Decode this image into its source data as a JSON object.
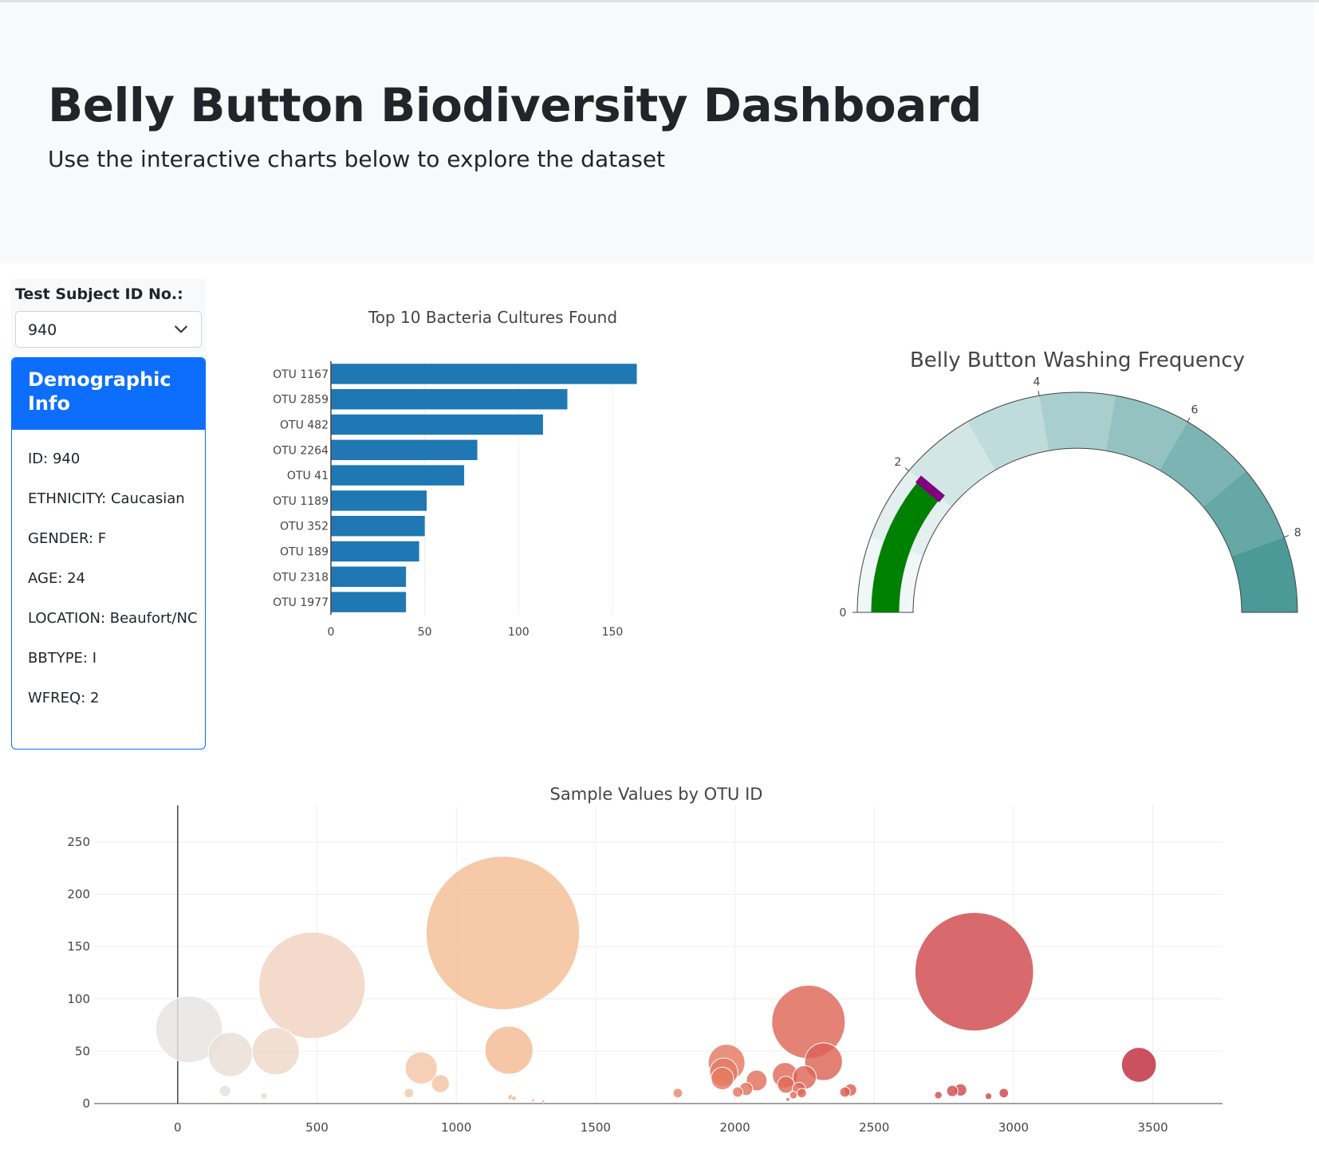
{
  "header": {
    "title": "Belly Button Biodiversity Dashboard",
    "subtitle": "Use the interactive charts below to explore the dataset"
  },
  "selector": {
    "label": "Test Subject ID No.:",
    "selected": "940"
  },
  "demographics": {
    "title": "Demographic Info",
    "entries": [
      "ID: 940",
      "ETHNICITY: Caucasian",
      "GENDER: F",
      "AGE: 24",
      "LOCATION: Beaufort/NC",
      "BBTYPE: I",
      "WFREQ: 2"
    ]
  },
  "colors": {
    "bar": "#1f77b4",
    "panel_accent": "#0d6efd",
    "gauge_value": "#008000",
    "gauge_threshold": "#800080"
  },
  "chart_data": [
    {
      "type": "bar",
      "orientation": "horizontal",
      "title": "Top 10 Bacteria Cultures Found",
      "categories": [
        "OTU 1167",
        "OTU 2859",
        "OTU 482",
        "OTU 2264",
        "OTU 41",
        "OTU 1189",
        "OTU 352",
        "OTU 189",
        "OTU 2318",
        "OTU 1977"
      ],
      "values": [
        163,
        126,
        113,
        78,
        71,
        51,
        50,
        47,
        40,
        40
      ],
      "xlim": [
        0,
        170
      ],
      "xticks": [
        0,
        50,
        100,
        150
      ],
      "grid": true
    },
    {
      "type": "gauge",
      "title": "Belly Button Washing Frequency",
      "value": 2,
      "threshold": 2,
      "range": [
        0,
        9
      ],
      "ticks": [
        0,
        2,
        4,
        6,
        8
      ],
      "steps": [
        {
          "range": [
            0,
            1
          ],
          "color": "#f0f7f7"
        },
        {
          "range": [
            1,
            2
          ],
          "color": "#e4f0f0"
        },
        {
          "range": [
            2,
            3
          ],
          "color": "#d3e6e6"
        },
        {
          "range": [
            3,
            4
          ],
          "color": "#c0dbdb"
        },
        {
          "range": [
            4,
            5
          ],
          "color": "#a8cece"
        },
        {
          "range": [
            5,
            6
          ],
          "color": "#94c2c1"
        },
        {
          "range": [
            6,
            7
          ],
          "color": "#7bb4b3"
        },
        {
          "range": [
            7,
            8
          ],
          "color": "#65a8a6"
        },
        {
          "range": [
            8,
            9
          ],
          "color": "#4c9a98"
        }
      ]
    },
    {
      "type": "scatter",
      "mode": "bubble",
      "title": "Sample Values by OTU ID",
      "xlim": [
        -300,
        3750
      ],
      "ylim": [
        0,
        285
      ],
      "xticks": [
        0,
        500,
        1000,
        1500,
        2000,
        2500,
        3000,
        3500
      ],
      "yticks": [
        0,
        50,
        100,
        150,
        200,
        250
      ],
      "grid": true,
      "points": [
        {
          "x": 41,
          "y": 71
        },
        {
          "x": 170,
          "y": 12
        },
        {
          "x": 189,
          "y": 47
        },
        {
          "x": 310,
          "y": 7
        },
        {
          "x": 352,
          "y": 50
        },
        {
          "x": 482,
          "y": 113
        },
        {
          "x": 830,
          "y": 10
        },
        {
          "x": 874,
          "y": 34
        },
        {
          "x": 943,
          "y": 19
        },
        {
          "x": 1167,
          "y": 163
        },
        {
          "x": 1189,
          "y": 51
        },
        {
          "x": 1195,
          "y": 6
        },
        {
          "x": 1207,
          "y": 5
        },
        {
          "x": 1275,
          "y": 3
        },
        {
          "x": 1312,
          "y": 2
        },
        {
          "x": 1795,
          "y": 10
        },
        {
          "x": 1970,
          "y": 39
        },
        {
          "x": 1960,
          "y": 30
        },
        {
          "x": 1955,
          "y": 24
        },
        {
          "x": 2010,
          "y": 11
        },
        {
          "x": 2040,
          "y": 14
        },
        {
          "x": 2078,
          "y": 22
        },
        {
          "x": 2180,
          "y": 27
        },
        {
          "x": 2183,
          "y": 18
        },
        {
          "x": 2190,
          "y": 4
        },
        {
          "x": 2210,
          "y": 8
        },
        {
          "x": 2230,
          "y": 14
        },
        {
          "x": 2240,
          "y": 10
        },
        {
          "x": 2250,
          "y": 25
        },
        {
          "x": 2264,
          "y": 78
        },
        {
          "x": 2318,
          "y": 40
        },
        {
          "x": 2395,
          "y": 11
        },
        {
          "x": 2415,
          "y": 13
        },
        {
          "x": 2730,
          "y": 8
        },
        {
          "x": 2780,
          "y": 12
        },
        {
          "x": 2810,
          "y": 13
        },
        {
          "x": 2859,
          "y": 126
        },
        {
          "x": 2910,
          "y": 7
        },
        {
          "x": 2965,
          "y": 10
        },
        {
          "x": 3450,
          "y": 37
        }
      ],
      "colorscale": "Reds-ish (otu_ids)"
    }
  ]
}
